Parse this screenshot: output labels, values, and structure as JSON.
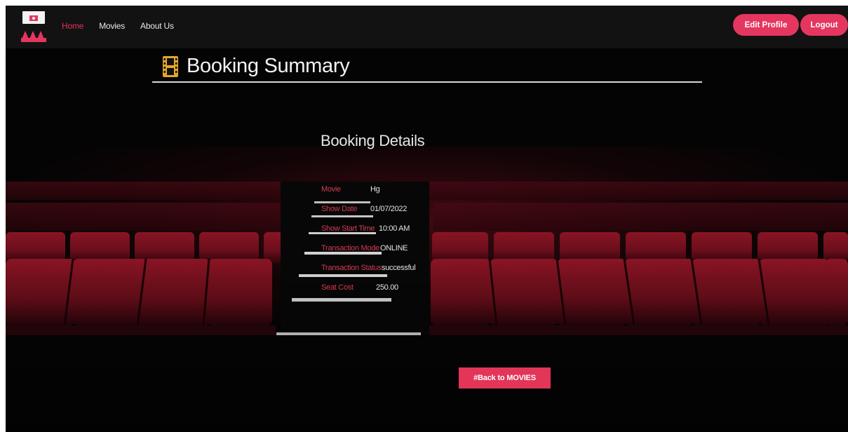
{
  "navbar": {
    "links": [
      {
        "label": "Home",
        "active": true
      },
      {
        "label": "Movies",
        "active": false
      },
      {
        "label": "About Us",
        "active": false
      }
    ],
    "edit_profile_label": "Edit Profile",
    "logout_label": "Logout"
  },
  "page": {
    "title": "Booking Summary",
    "icon": "film-icon"
  },
  "details": {
    "heading": "Booking Details",
    "rows": [
      {
        "label": "Movie",
        "value": "Hg"
      },
      {
        "label": "Show Date",
        "value": "01/07/2022"
      },
      {
        "label": "Show Start Time",
        "value": "10:00 AM"
      },
      {
        "label": "Transaction Mode",
        "value": "ONLINE"
      },
      {
        "label": "Transaction Status",
        "value": "successful"
      },
      {
        "label": "Seat Cost",
        "value": "250.00"
      }
    ]
  },
  "back_button_label": "#Back to MOVIES",
  "colors": {
    "accent": "#e53660",
    "label_red": "#d43a4f",
    "icon_gold": "#e2a72a",
    "background": "#040404"
  }
}
